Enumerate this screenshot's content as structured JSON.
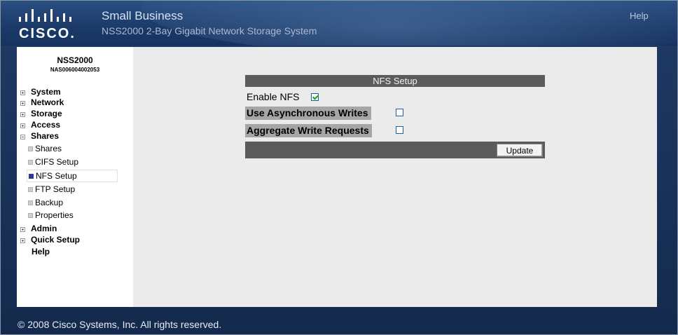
{
  "header": {
    "brand_title": "Small Business",
    "brand_subtitle": "NSS2000 2-Bay Gigabit Network Storage System",
    "logo_text": "CISCO.",
    "help_label": "Help"
  },
  "sidebar": {
    "device_name": "NSS2000",
    "device_serial": "NAS006004002053",
    "items": [
      {
        "label": "System",
        "expander": "plus"
      },
      {
        "label": "Network",
        "expander": "plus"
      },
      {
        "label": "Storage",
        "expander": "plus"
      },
      {
        "label": "Access",
        "expander": "plus"
      },
      {
        "label": "Shares",
        "expander": "minus"
      }
    ],
    "share_subitems": [
      {
        "label": "Shares"
      },
      {
        "label": "CIFS Setup"
      },
      {
        "label": "NFS Setup",
        "active": true
      },
      {
        "label": "FTP Setup"
      },
      {
        "label": "Backup"
      },
      {
        "label": "Properties"
      }
    ],
    "bottom_items": [
      {
        "label": "Admin",
        "expander": "plus"
      },
      {
        "label": "Quick Setup",
        "expander": "plus"
      },
      {
        "label": "Help",
        "expander": "none"
      }
    ]
  },
  "main": {
    "section_title": "NFS Setup",
    "enable_nfs_label": "Enable NFS",
    "enable_nfs_checked": true,
    "async_writes_label": "Use Asynchronous Writes",
    "async_writes_checked": false,
    "aggregate_writes_label": "Aggregate Write Requests",
    "aggregate_writes_checked": false,
    "update_label": "Update"
  },
  "footer": {
    "copyright": "© 2008 Cisco Systems, Inc. All rights reserved."
  },
  "colors": {
    "header_blue": "#1b3a68",
    "section_bar": "#5b5b5b",
    "label_bg": "#a6a6a6",
    "checkbox_border": "#1c5fa1",
    "check_mark": "#1aa01a",
    "active_marker": "#2b3d8a"
  }
}
